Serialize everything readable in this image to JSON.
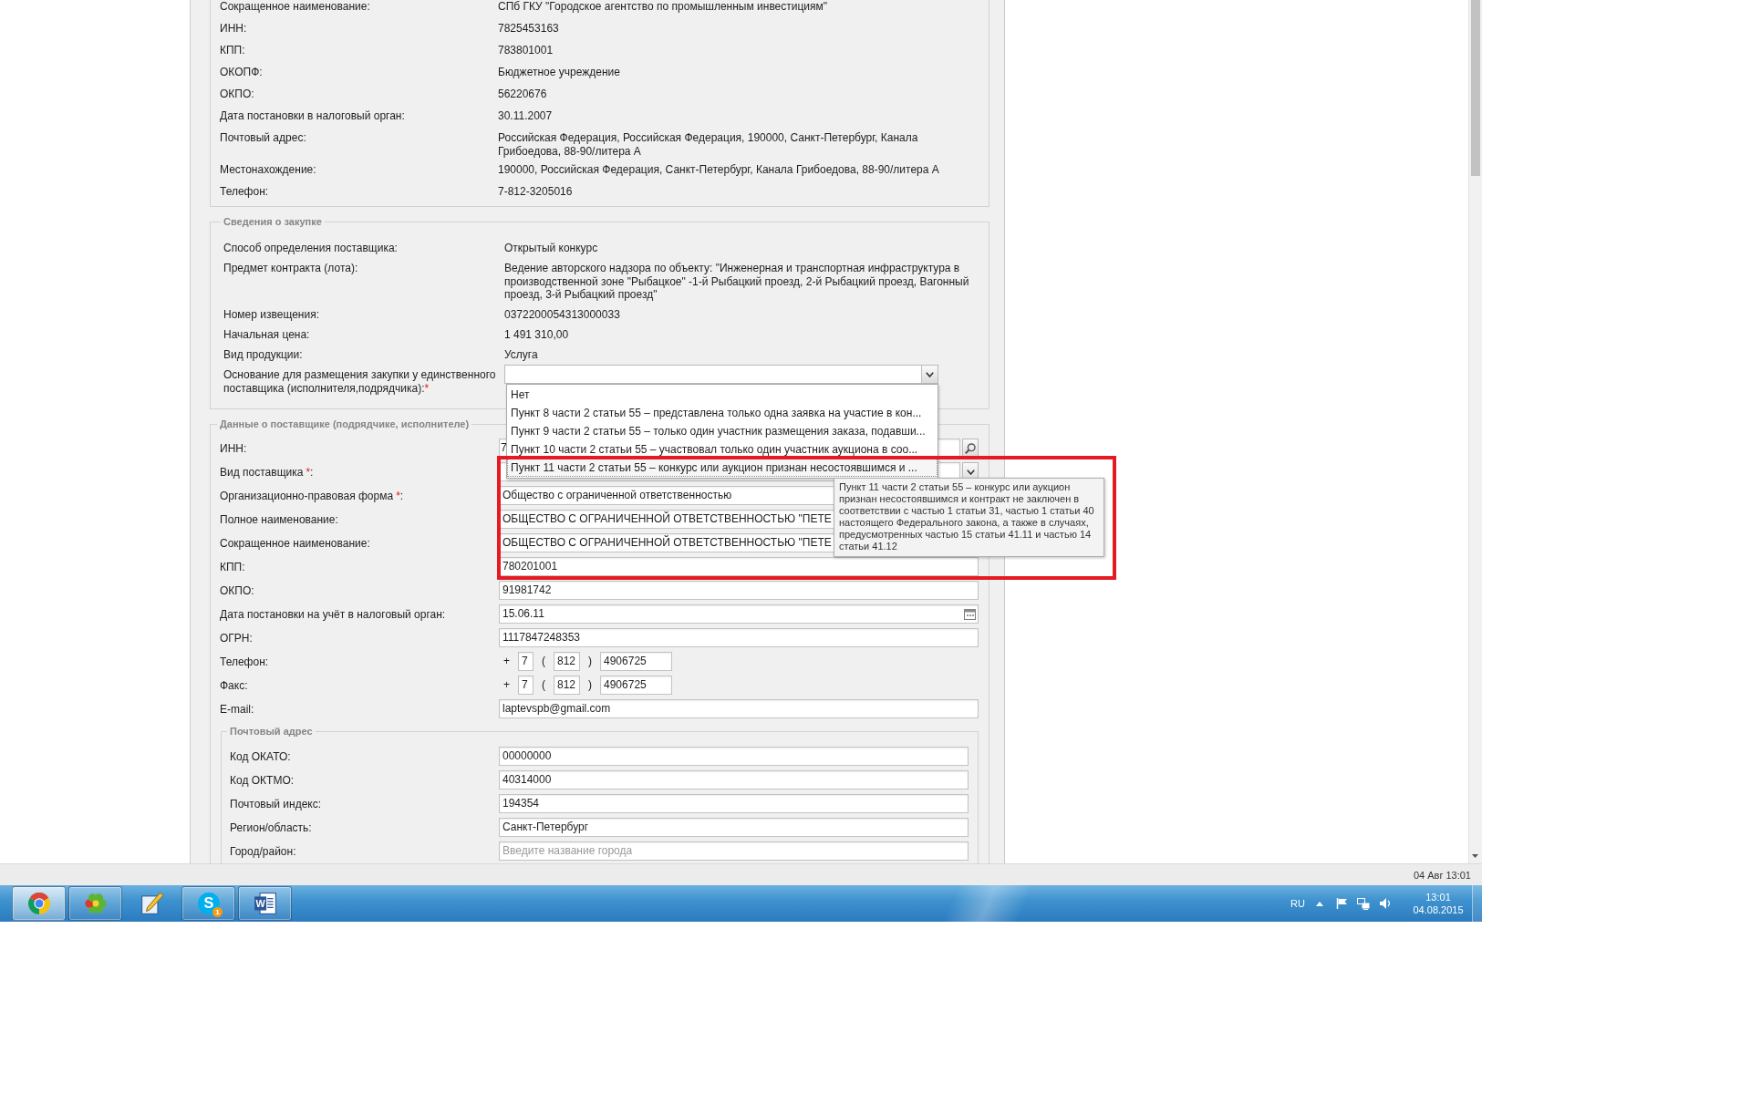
{
  "org_info": {
    "rows": [
      {
        "label": "Сокращенное наименование:",
        "value": "СПб ГКУ \"Городское агентство по промышленным инвестициям\""
      },
      {
        "label": "ИНН:",
        "value": "7825453163"
      },
      {
        "label": "КПП:",
        "value": "783801001"
      },
      {
        "label": "ОКОПФ:",
        "value": "Бюджетное учреждение"
      },
      {
        "label": "ОКПО:",
        "value": "56220676"
      },
      {
        "label": "Дата постановки в налоговый орган:",
        "value": "30.11.2007"
      },
      {
        "label": "Почтовый адрес:",
        "value": "Российская Федерация, Российская Федерация, 190000, Санкт-Петербург, Канала Грибоедова, 88-90/литера А"
      },
      {
        "label": "Местонахождение:",
        "value": "190000, Российская Федерация, Санкт-Петербург, Канала Грибоедова, 88-90/литера А"
      },
      {
        "label": "Телефон:",
        "value": "7-812-3205016"
      }
    ]
  },
  "procurement": {
    "legend": "Сведения о закупке",
    "rows": [
      {
        "label": "Способ определения поставщика:",
        "value": "Открытый конкурс"
      },
      {
        "label": "Предмет контракта (лота):",
        "value": "Ведение авторского надзора по объекту: \"Инженерная и транспортная инфраструктура в производственной зоне \"Рыбацкое\" -1-й Рыбацкий проезд, 2-й Рыбацкий проезд, Вагонный проезд, 3-й Рыбацкий проезд\""
      },
      {
        "label": "Номер извещения:",
        "value": "0372200054313000033"
      },
      {
        "label": "Начальная цена:",
        "value": "1 491 310,00"
      },
      {
        "label": "Вид продукции:",
        "value": "Услуга"
      }
    ],
    "basis": {
      "label": "Основание для размещения закупки у единственного поставщика (исполнителя,подрядчика):",
      "required_mark": "*",
      "expanded": true,
      "options": [
        {
          "text": "Нет",
          "selected": false
        },
        {
          "text": "Пункт 8 части 2 статьи 55 – представлена только одна заявка на участие в кон...",
          "selected": false
        },
        {
          "text": "Пункт 9 части 2 статьи 55 – только один участник размещения заказа, подавши...",
          "selected": false
        },
        {
          "text": "Пункт 10 части 2 статьи 55 – участвовал только один участник аукциона в соо...",
          "selected": false
        },
        {
          "text": "Пункт 11 части 2 статьи 55 – конкурс или аукцион признан несостоявшимся и ...",
          "selected": true
        }
      ],
      "tooltip": "Пункт 11 части 2 статьи 55 – конкурс или аукцион признан несостоявшимся и контракт не заключен в соответствии с частью 1 статьи 31, частью 1 статьи 40 настоящего Федерального закона, а также в случаях, предусмотренных частью 15 статьи 41.11 и частью 14 статьи 41.12"
    }
  },
  "supplier": {
    "legend": "Данные о поставщике (подрядчике, исполнителе)",
    "fields": [
      {
        "kind": "lookup",
        "label": "ИНН:",
        "value": "7"
      },
      {
        "kind": "combo",
        "label": "Вид поставщика",
        "required_mark": "*",
        "label_suffix": ":"
      },
      {
        "kind": "text",
        "label": "Организационно-правовая форма",
        "required_mark": "*",
        "label_suffix": ":",
        "value": "Общество с ограниченной ответственностью"
      },
      {
        "kind": "text",
        "label": "Полное наименование:",
        "value": "ОБЩЕСТВО С ОГРАНИЧЕННОЙ ОТВЕТСТВЕННОСТЬЮ \"ПЕТЕ"
      },
      {
        "kind": "text",
        "label": "Сокращенное наименование:",
        "value": "ОБЩЕСТВО С ОГРАНИЧЕННОЙ ОТВЕТСТВЕННОСТЬЮ \"ПЕТЕ"
      },
      {
        "kind": "text",
        "label": "КПП:",
        "value": "780201001"
      },
      {
        "kind": "text",
        "label": "ОКПО:",
        "value": "91981742"
      },
      {
        "kind": "date",
        "label": "Дата постановки на учёт в налоговый орган:",
        "value": "15.06.11"
      },
      {
        "kind": "text",
        "label": "ОГРН:",
        "value": "1117847248353"
      },
      {
        "kind": "phone",
        "label": "Телефон:",
        "parts": [
          {
            "kind": "sign",
            "text": "+"
          },
          {
            "kind": "country_code",
            "value": "7"
          },
          {
            "kind": "sign",
            "text": "("
          },
          {
            "kind": "area_code",
            "value": "812"
          },
          {
            "kind": "sign",
            "text": ")"
          },
          {
            "kind": "number",
            "value": "4906725"
          }
        ]
      },
      {
        "kind": "phone",
        "label": "Факс:",
        "parts": [
          {
            "kind": "sign",
            "text": "+"
          },
          {
            "kind": "country_code",
            "value": "7"
          },
          {
            "kind": "sign",
            "text": "("
          },
          {
            "kind": "area_code",
            "value": "812"
          },
          {
            "kind": "sign",
            "text": ")"
          },
          {
            "kind": "number",
            "value": "4906725"
          }
        ]
      },
      {
        "kind": "text",
        "label": "E-mail:",
        "value": "laptevspb@gmail.com"
      }
    ],
    "postal_address": {
      "legend": "Почтовый адрес",
      "fields": [
        {
          "kind": "text",
          "label": "Код ОКАТО:",
          "value": "00000000"
        },
        {
          "kind": "text",
          "label": "Код ОКТМО:",
          "value": "40314000"
        },
        {
          "kind": "text",
          "label": "Почтовый индекс:",
          "value": "194354"
        },
        {
          "kind": "text",
          "label": "Регион/область:",
          "value": "Санкт-Петербург"
        },
        {
          "kind": "text",
          "label": "Город/район:",
          "placeholder": "Введите название города"
        }
      ]
    }
  },
  "status_bar": {
    "datetime": "04 Авг 13:01"
  },
  "taskbar": {
    "apps": [
      {
        "kind": "browser",
        "running": true,
        "selected": true
      },
      {
        "kind": "flower",
        "running": true,
        "selected": false
      },
      {
        "kind": "pencil",
        "running": false,
        "selected": false
      },
      {
        "kind": "messenger",
        "letter": "S",
        "badge": "1",
        "running": true,
        "selected": false
      },
      {
        "kind": "document",
        "letter": "W",
        "running": true,
        "selected": false
      }
    ],
    "tray": {
      "language": "RU",
      "time": "13:01",
      "date": "04.08.2015"
    }
  }
}
